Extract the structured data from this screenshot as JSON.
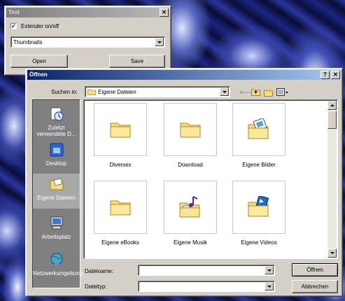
{
  "test_window": {
    "title": "Test",
    "close_glyph": "✕",
    "checkbox_label": "Extender on/off",
    "checkbox_checked": true,
    "checkbox_mark": "✓",
    "mode_select_value": "Thumbnails",
    "open_label": "Open",
    "save_label": "Save"
  },
  "dialog": {
    "title": "Öffnen",
    "help_glyph": "?",
    "close_glyph": "✕",
    "look_in_label": "Suchen in:",
    "look_in_value": "Eigene Dateien",
    "places": [
      {
        "label": "Zuletzt verwendete D...",
        "icon": "recent-documents-icon"
      },
      {
        "label": "Desktop",
        "icon": "desktop-icon"
      },
      {
        "label": "Eigene Dateien",
        "icon": "my-documents-icon",
        "active": true
      },
      {
        "label": "Arbeitsplatz",
        "icon": "my-computer-icon"
      },
      {
        "label": "Netzwerkumgebung",
        "icon": "network-icon"
      }
    ],
    "files": [
      {
        "name": "Diverses",
        "icon": "folder-icon"
      },
      {
        "name": "Download",
        "icon": "folder-icon"
      },
      {
        "name": "Eigene Bilder",
        "icon": "pictures-folder-icon"
      },
      {
        "name": "Eigene eBooks",
        "icon": "folder-icon"
      },
      {
        "name": "Eigene Musik",
        "icon": "music-folder-icon"
      },
      {
        "name": "Eigene Videos",
        "icon": "videos-folder-icon"
      }
    ],
    "filename_label": "Dateiname:",
    "filename_value": "",
    "filetype_label": "Dateityp:",
    "filetype_value": "",
    "open_button": "Öffnen",
    "cancel_button": "Abbrechen"
  }
}
